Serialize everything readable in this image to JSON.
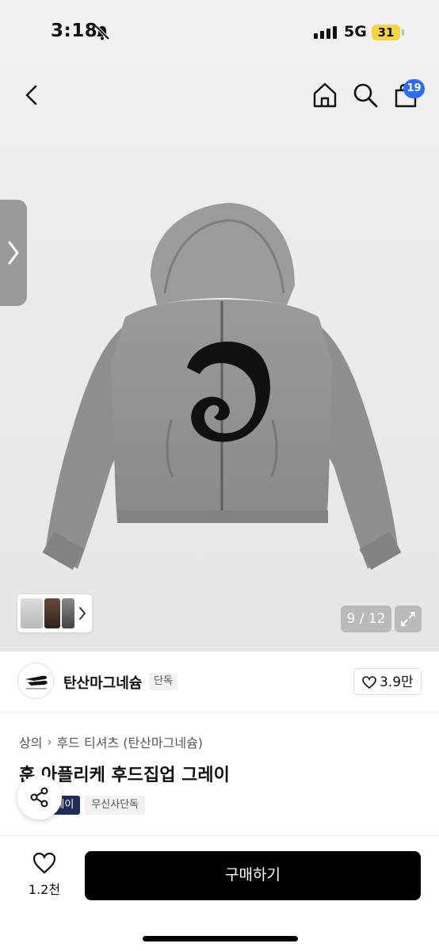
{
  "status_bar": {
    "time": "3:18",
    "network": "5G",
    "battery": "31",
    "icons": [
      "bell-slash-icon",
      "signal-icon"
    ]
  },
  "nav": {
    "icons": [
      "back-icon",
      "home-icon",
      "search-icon",
      "cart-icon"
    ],
    "cart_badge": "19"
  },
  "gallery": {
    "counter": "9 / 12",
    "icons": [
      "side-chevron-icon",
      "thumb-chevron-icon",
      "expand-icon"
    ]
  },
  "brand": {
    "name": "탄산마그네슘",
    "tag": "단독",
    "likes": "3.9만"
  },
  "product": {
    "breadcrumb": [
      "상의",
      "후드 티셔츠 (탄산마그네슘)"
    ],
    "title": "훈 아플리케 후드집업 그레이",
    "tags": [
      "레이",
      "무신사단독"
    ]
  },
  "bottom_bar": {
    "wish_count": "1.2천",
    "buy_label": "구매하기"
  },
  "colors": {
    "buy_button": "#000000",
    "cart_badge": "#2d6cf5",
    "tag_dark": "#1e2c5a",
    "battery": "#f6d640"
  }
}
